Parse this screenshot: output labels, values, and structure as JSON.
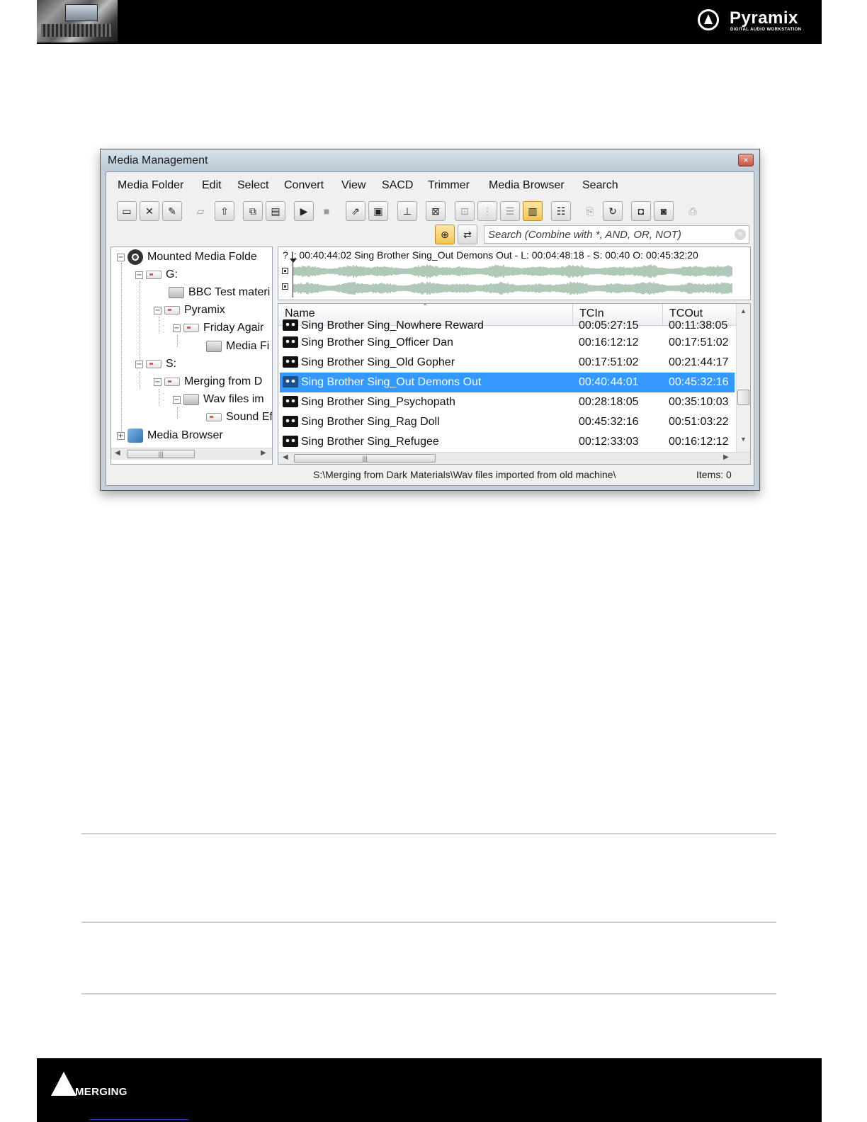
{
  "page": {
    "logo": {
      "word": "Pyramix",
      "sub": "DIGITAL AUDIO WORKSTATION"
    },
    "footer_logo": "MERGING"
  },
  "window": {
    "title": "Media Management",
    "close": "×"
  },
  "menu": [
    "Media Folder",
    "Edit",
    "Select",
    "Convert",
    "View",
    "SACD",
    "Trimmer",
    "Media Browser",
    "Search"
  ],
  "toolbar": {
    "buttons": [
      "drive-icon",
      "unmount-icon",
      "rename-icon",
      "open-icon",
      "up-folder-icon",
      "copy-icon",
      "paste-icon",
      "play-icon",
      "stop-icon",
      "export-icon",
      "clipboard-icon",
      "stamp-icon",
      "hide-icon",
      "details-icon",
      "tree-icon",
      "list-icon",
      "columns-icon",
      "properties-icon",
      "import-icon",
      "refresh-icon",
      "add-robot-icon",
      "robot-icon",
      "print-icon"
    ],
    "globe": "globe-icon",
    "swap": "swap-icon"
  },
  "search": {
    "placeholder": "Search  (Combine with *, AND, OR, NOT)",
    "clear": "×"
  },
  "tree": {
    "root": "Mounted Media Folde",
    "g": "G:",
    "bbc": "BBC Test materi",
    "pyramix": "Pyramix",
    "friday": "Friday Agair",
    "media_fi": "Media Fi",
    "s": "S:",
    "merging": "Merging from D",
    "wav": "Wav files im",
    "sound": "Sound Ef",
    "browser": "Media Browser"
  },
  "waveform": {
    "info": "?   I: 00:40:44:02   Sing Brother Sing_Out Demons Out - L: 00:04:48:18 - S: 00:40   O: 00:45:32:20"
  },
  "list": {
    "columns": {
      "name": "Name",
      "tcin": "TCIn",
      "tcout": "TCOut"
    },
    "partial_top": {
      "name": "Sing Brother Sing_Nowhere Reward",
      "tcin": "00:05:27:15",
      "tcout": "00:11:38:05"
    },
    "rows": [
      {
        "name": "Sing Brother Sing_Officer Dan",
        "tcin": "00:16:12:12",
        "tcout": "00:17:51:02"
      },
      {
        "name": "Sing Brother Sing_Old Gopher",
        "tcin": "00:17:51:02",
        "tcout": "00:21:44:17"
      },
      {
        "name": "Sing Brother Sing_Out Demons Out",
        "tcin": "00:40:44:01",
        "tcout": "00:45:32:16"
      },
      {
        "name": "Sing Brother Sing_Psychopath",
        "tcin": "00:28:18:05",
        "tcout": "00:35:10:03"
      },
      {
        "name": "Sing Brother Sing_Rag Doll",
        "tcin": "00:45:32:16",
        "tcout": "00:51:03:22"
      },
      {
        "name": "Sing Brother Sing_Refugee",
        "tcin": "00:12:33:03",
        "tcout": "00:16:12:12"
      }
    ],
    "selected_index": 2
  },
  "status": {
    "path": "S:\\Merging from Dark Materials\\Wav files imported from old machine\\",
    "items": "Items: 0"
  }
}
